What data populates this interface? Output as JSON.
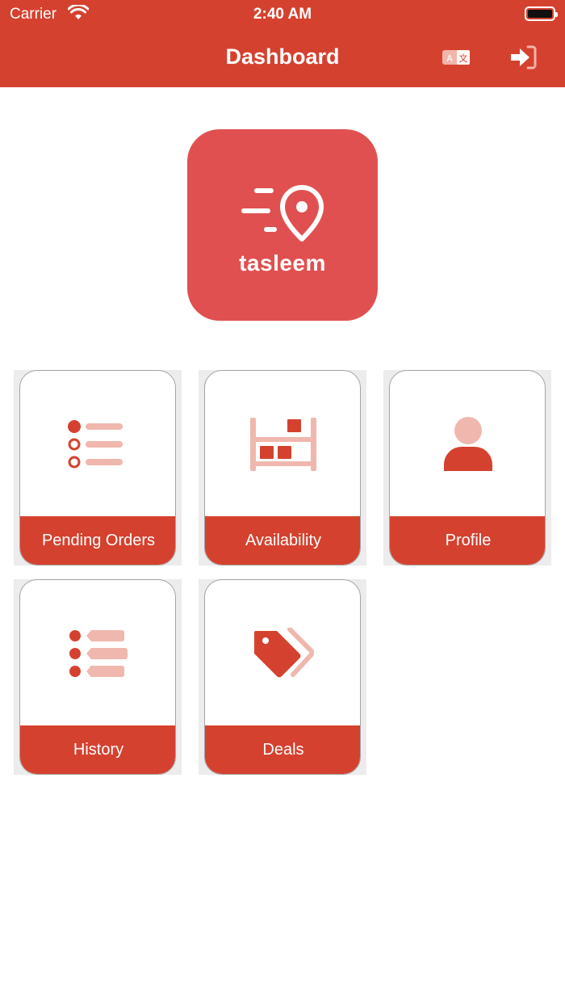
{
  "status_bar": {
    "carrier": "Carrier",
    "time": "2:40 AM"
  },
  "header": {
    "title": "Dashboard",
    "language_icon": "language-icon",
    "logout_icon": "logout-icon"
  },
  "logo": {
    "text": "tasleem",
    "icon": "location-pin-icon"
  },
  "colors": {
    "primary": "#d5412f",
    "logo_bg": "#e05050",
    "icon_light": "#f0b7ae"
  },
  "tiles": [
    {
      "label": "Pending Orders",
      "icon": "pending-orders-icon"
    },
    {
      "label": "Availability",
      "icon": "availability-icon"
    },
    {
      "label": "Profile",
      "icon": "profile-icon"
    },
    {
      "label": "History",
      "icon": "history-icon"
    },
    {
      "label": "Deals",
      "icon": "deals-icon"
    }
  ]
}
